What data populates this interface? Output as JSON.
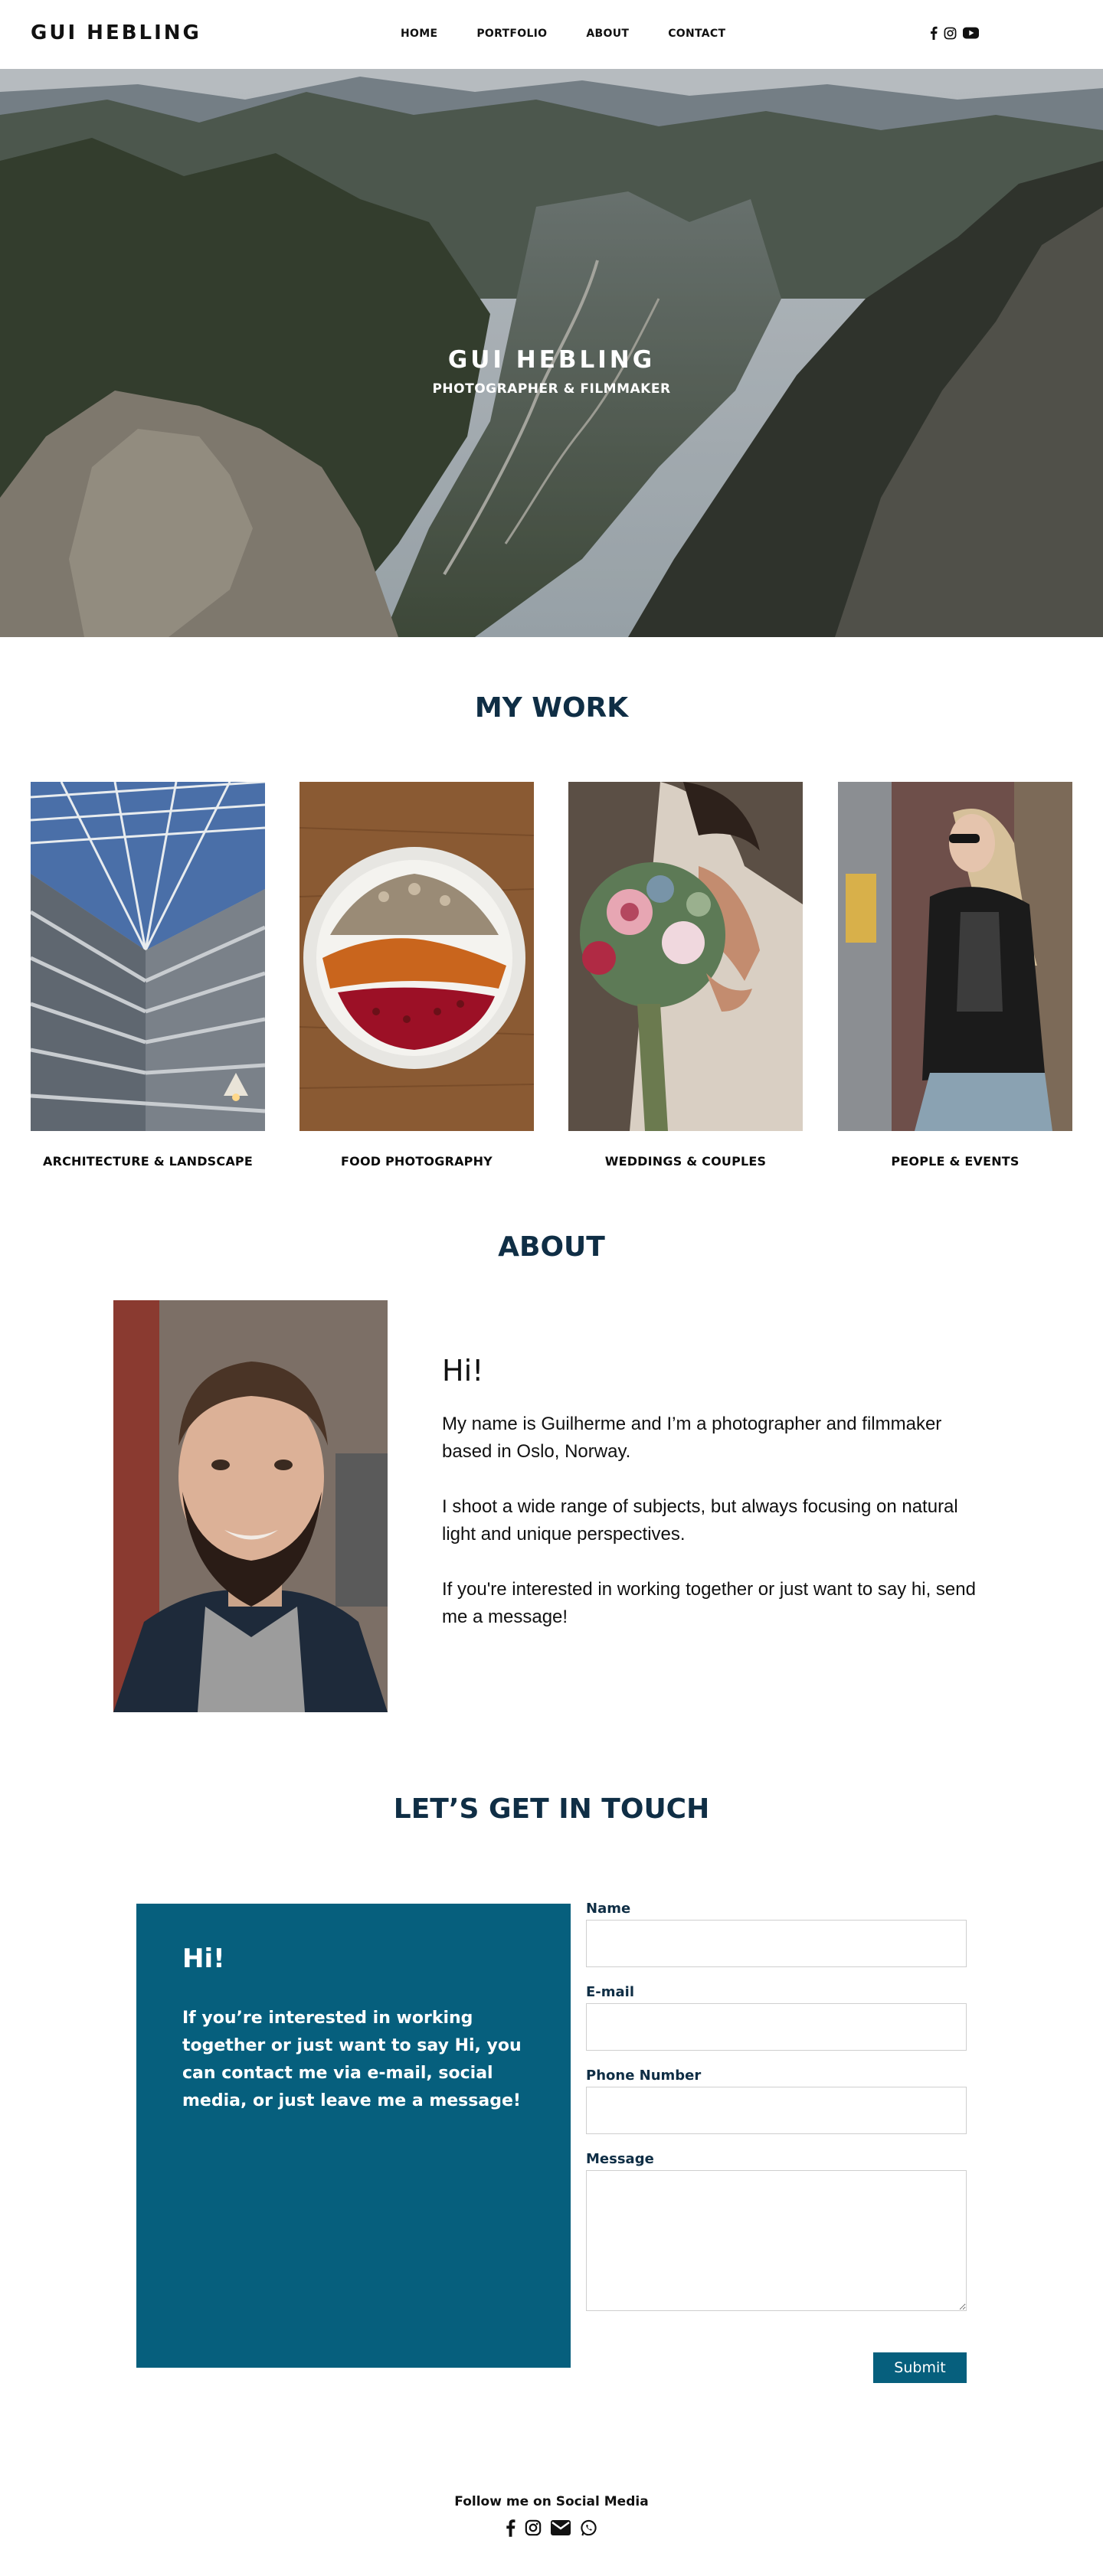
{
  "header": {
    "brand": "GUI HEBLING",
    "nav": [
      "HOME",
      "PORTFOLIO",
      "ABOUT",
      "CONTACT"
    ],
    "social_icons": [
      "facebook-icon",
      "instagram-icon",
      "youtube-icon"
    ]
  },
  "hero": {
    "title": "GUI HEBLING",
    "subtitle": "PHOTOGRAPHER & FILMMAKER"
  },
  "work": {
    "title": "MY WORK",
    "items": [
      {
        "caption": "ARCHITECTURE & LANDSCAPE"
      },
      {
        "caption": "FOOD PHOTOGRAPHY"
      },
      {
        "caption": "WEDDINGS & COUPLES"
      },
      {
        "caption": "PEOPLE & EVENTS"
      }
    ]
  },
  "about": {
    "title": "ABOUT",
    "greeting": "Hi!",
    "paragraphs": [
      "My name is Guilherme and I’m a photographer and filmmaker based in Oslo, Norway.",
      "I shoot a wide range of subjects, but always focusing on natural light and unique perspectives.",
      "If you're interested in working together or just want to say hi, send me a message!"
    ]
  },
  "contact": {
    "title": "LET’S GET IN TOUCH",
    "panel_greeting": "Hi!",
    "panel_message": "If you’re interested in working together or just want to say Hi, you can contact me via e-mail, social media, or just leave me a message!",
    "labels": {
      "name": "Name",
      "email": "E-mail",
      "phone": "Phone Number",
      "message": "Message"
    },
    "values": {
      "name": "",
      "email": "",
      "phone": "",
      "message": ""
    },
    "submit": "Submit"
  },
  "footer": {
    "follow": "Follow me on Social Media",
    "social_icons": [
      "facebook-icon",
      "instagram-icon",
      "email-icon",
      "whatsapp-icon"
    ]
  },
  "colors": {
    "accent": "#065f7d",
    "title": "#0f2e45"
  }
}
